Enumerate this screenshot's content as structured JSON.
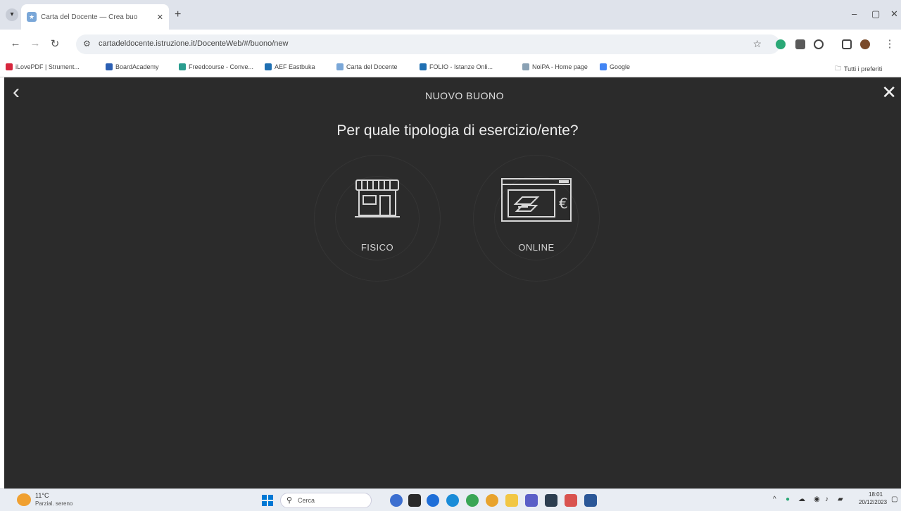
{
  "browser": {
    "tab_title": "Carta del Docente — Crea buo",
    "tab_favicon_icon": "carta-docente-favicon",
    "url": "cartadeldocente.istruzione.it/DocenteWeb/#/buono/new",
    "bookmarks": [
      {
        "label": "iLovePDF | Strument...",
        "color": "#d7263d"
      },
      {
        "label": "BoardAcademy",
        "color": "#2b5fb3"
      },
      {
        "label": "Freedcourse - Conve...",
        "color": "#2a9d8f"
      },
      {
        "label": "AEF Eastbuka",
        "color": "#1f6fb2"
      },
      {
        "label": "Carta del Docente",
        "color": "#7aa7d8"
      },
      {
        "label": "FOLIO - Istanze Onli...",
        "color": "#1f6fb2"
      },
      {
        "label": "NoiPA - Home page",
        "color": "#8aa1b4"
      },
      {
        "label": "Google",
        "color": "#4285f4"
      }
    ],
    "all_bookmarks_label": "Tutti i preferiti"
  },
  "page": {
    "header": "NUOVO BUONO",
    "question": "Per quale tipologia di esercizio/ente?",
    "options": [
      {
        "label": "FISICO",
        "icon": "shop-icon"
      },
      {
        "label": "ONLINE",
        "icon": "online-payment-icon"
      }
    ]
  },
  "taskbar": {
    "weather_temp": "11°C",
    "weather_desc": "Parzial. sereno",
    "search_placeholder": "Cerca",
    "time": "18:01",
    "date": "20/12/2023"
  },
  "colors": {
    "page_bg": "#2b2b2b",
    "text_light": "#ededed",
    "taskbar_bg": "#e9edf3",
    "windows_blue": "#0078d4"
  }
}
